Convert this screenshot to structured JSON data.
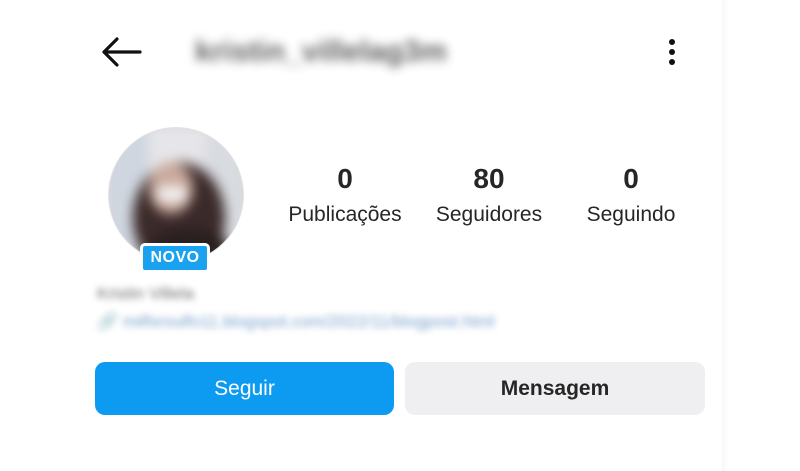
{
  "header": {
    "back_icon": "arrow-left-icon",
    "username": "kristin_villelag3m",
    "more_icon": "more-vertical-icon"
  },
  "profile": {
    "avatar": "profile-photo",
    "badge": "NOVO",
    "stats": [
      {
        "value": "0",
        "label": "Publicações"
      },
      {
        "value": "80",
        "label": "Seguidores"
      },
      {
        "value": "0",
        "label": "Seguindo"
      }
    ],
    "bio_name": "Kristin Villela",
    "bio_link": "🔗 milfsroulfo11.blogspot.com/2022/11/blogpost.html"
  },
  "actions": {
    "follow_label": "Seguir",
    "message_label": "Mensagem"
  },
  "colors": {
    "accent": "#0d9bf1",
    "badge": "#1aa1f0",
    "secondary_button": "#efeff1",
    "text": "#262626"
  }
}
